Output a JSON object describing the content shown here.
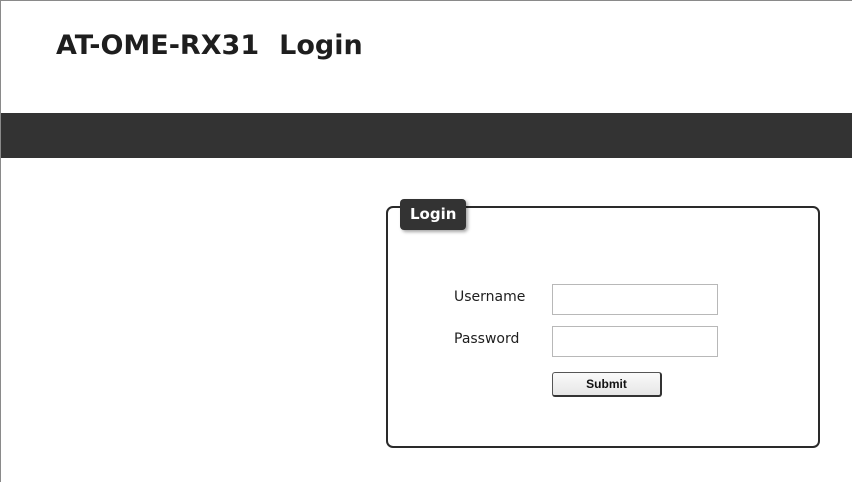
{
  "header": {
    "device_name": "AT-OME-RX31",
    "page_name": "Login"
  },
  "login_panel": {
    "tab_label": "Login",
    "username_label": "Username",
    "username_value": "",
    "password_label": "Password",
    "password_value": "",
    "submit_label": "Submit"
  },
  "colors": {
    "nav_bar": "#333333",
    "tab_background": "#333333",
    "panel_border": "#2a2a2a",
    "text": "#1e1e1e"
  }
}
